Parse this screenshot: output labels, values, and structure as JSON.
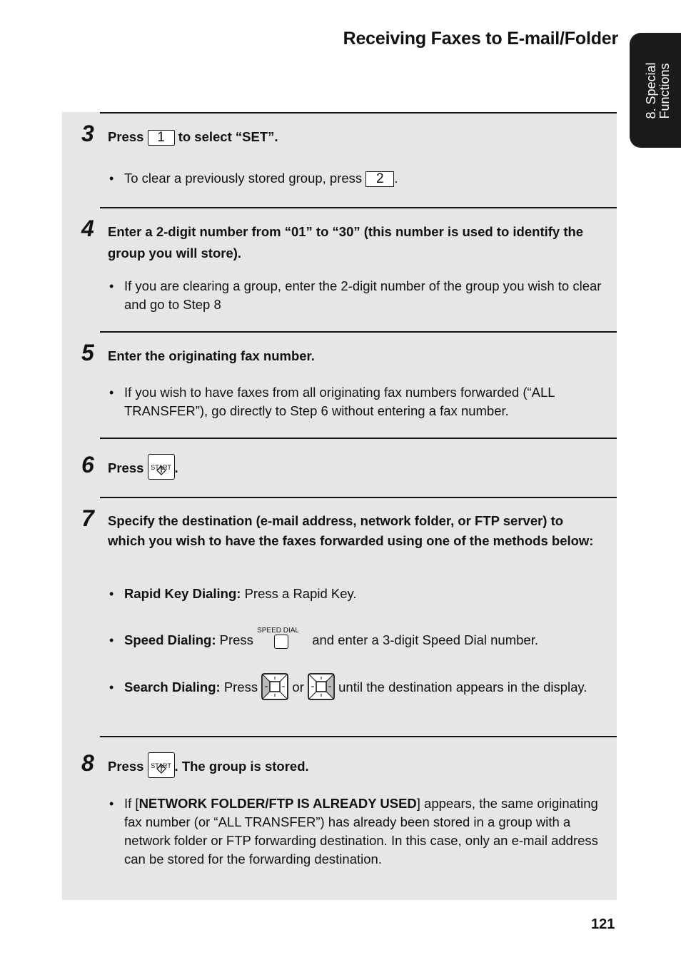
{
  "header": {
    "title": "Receiving Faxes to E-mail/Folder"
  },
  "side_tab": {
    "line1": "8. Special",
    "line2": "Functions"
  },
  "steps": [
    {
      "number": "3",
      "head_pre": "Press",
      "key": "1",
      "head_post": "to select “SET”.",
      "bullets": [
        {
          "pre": "To clear a previously stored group, press",
          "key": "2",
          "post": "."
        }
      ]
    },
    {
      "number": "4",
      "head": "Enter a 2-digit number from “01” to “30” (this number is used to identify the group you will store).",
      "bullets": [
        {
          "text": "If you are clearing a group, enter the 2-digit number of the group you wish to clear and go to Step 8"
        }
      ]
    },
    {
      "number": "5",
      "head": "Enter the originating fax number.",
      "bullets": [
        {
          "text": "If you wish to have faxes from all originating fax numbers forwarded (“ALL TRANSFER”), go directly to Step 6 without entering a fax number."
        }
      ]
    },
    {
      "number": "6",
      "head_pre": "Press",
      "key_label": "START",
      "head_post": "."
    },
    {
      "number": "7",
      "head": "Specify the destination (e-mail address, network folder, or FTP server) to which you wish to have the faxes forwarded using one of the methods below:",
      "bullets": [
        {
          "bold": "Rapid Key Dialing:",
          "text": "Press a Rapid Key."
        },
        {
          "bold": "Speed Dialing:",
          "pre": "Press",
          "key_label": "SPEED DIAL",
          "post": "and enter a 3-digit Speed Dial number."
        },
        {
          "bold": "Search Dialing:",
          "pre": "Press",
          "mid": "or",
          "post": "until the destination appears in the display."
        }
      ]
    },
    {
      "number": "8",
      "head_pre": "Press",
      "key_label": "START",
      "head_post": ". The group is stored.",
      "bullets": [
        {
          "pre": "If [",
          "bold": "NETWORK FOLDER/FTP IS ALREADY USED",
          "post": "] appears, the same originating fax number (or “ALL TRANSFER”) has already been stored in a group with a network folder or FTP forwarding destination. In this case, only an e-mail address can be stored for the forwarding destination."
        }
      ]
    }
  ],
  "footer": {
    "page_number": "121"
  }
}
